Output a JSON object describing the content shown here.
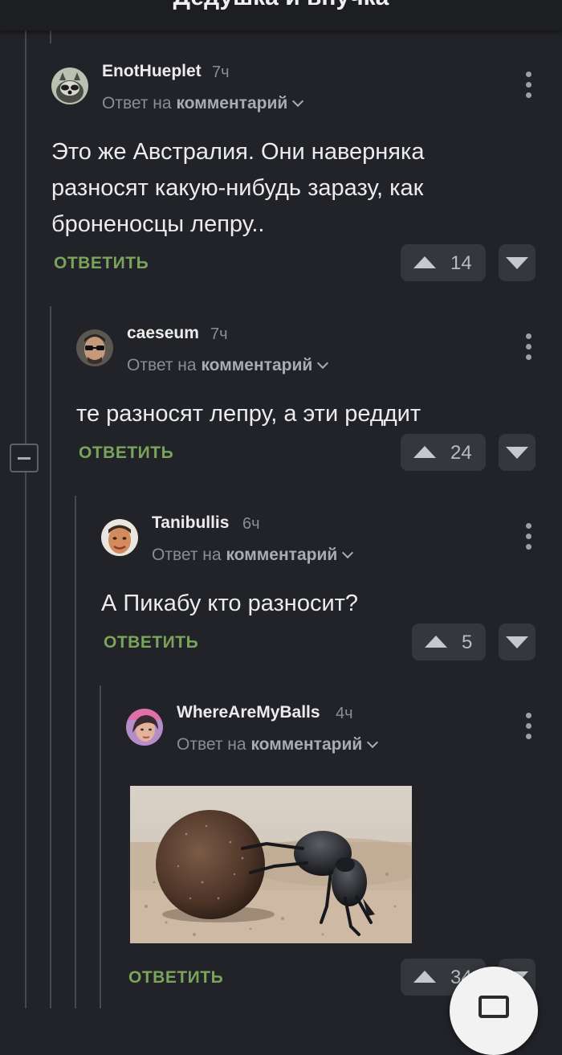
{
  "header": {
    "title": "Дедушка и внучка"
  },
  "comments": [
    {
      "username": "EnotHueplet",
      "time": "7ч",
      "reply_prefix": "Ответ на",
      "reply_link": "комментарий",
      "text": "Это же Австралия. Они наверняка разносят какую-нибудь заразу, как броненосцы лепру..",
      "reply_label": "ОТВЕТИТЬ",
      "rating": "14"
    },
    {
      "username": "caeseum",
      "time": "7ч",
      "reply_prefix": "Ответ на",
      "reply_link": "комментарий",
      "text": "те разносят лепру, а эти реддит",
      "reply_label": "ОТВЕТИТЬ",
      "rating": "24"
    },
    {
      "username": "Tanibullis",
      "time": "6ч",
      "reply_prefix": "Ответ на",
      "reply_link": "комментарий",
      "text": "А Пикабу кто разносит?",
      "reply_label": "ОТВЕТИТЬ",
      "rating": "5"
    },
    {
      "username": "WhereAreMyBalls",
      "time": "4ч",
      "reply_prefix": "Ответ на",
      "reply_link": "комментарий",
      "image_subject": "dung beetle rolling a dung ball",
      "reply_label": "ОТВЕТИТЬ",
      "rating": "34"
    }
  ],
  "colors": {
    "background": "#212328",
    "reply_green": "#7aa35c",
    "thread_line": "#46494f",
    "vote_button": "#34373c"
  },
  "icons": [
    "avatar",
    "more-vertical-icon",
    "chevron-down-icon",
    "upvote-icon",
    "downvote-icon",
    "collapse-icon",
    "comment-fab-icon"
  ]
}
